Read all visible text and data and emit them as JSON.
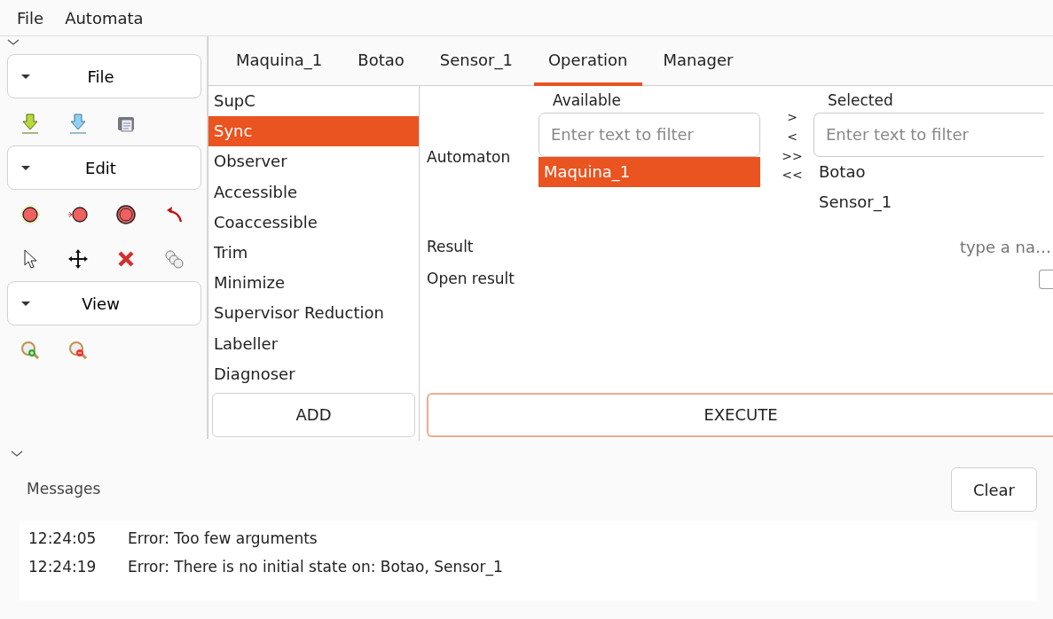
{
  "menu": [
    "File",
    "Automata"
  ],
  "sidebar": {
    "sections": [
      {
        "title": "File",
        "expanded": true
      },
      {
        "title": "Edit",
        "expanded": true
      },
      {
        "title": "View",
        "expanded": true
      }
    ]
  },
  "tabs": [
    {
      "label": "Maquina_1",
      "selected": false
    },
    {
      "label": "Botao",
      "selected": false
    },
    {
      "label": "Sensor_1",
      "selected": false
    },
    {
      "label": "Operation",
      "selected": true
    },
    {
      "label": "Manager",
      "selected": false
    }
  ],
  "operations": [
    {
      "label": "SupC",
      "selected": false
    },
    {
      "label": "Sync",
      "selected": true
    },
    {
      "label": "Observer",
      "selected": false
    },
    {
      "label": "Accessible",
      "selected": false
    },
    {
      "label": "Coaccessible",
      "selected": false
    },
    {
      "label": "Trim",
      "selected": false
    },
    {
      "label": "Minimize",
      "selected": false
    },
    {
      "label": "Supervisor Reduction",
      "selected": false
    },
    {
      "label": "Labeller",
      "selected": false
    },
    {
      "label": "Diagnoser",
      "selected": false
    }
  ],
  "add_button": "ADD",
  "automaton": {
    "label": "Automaton",
    "available": {
      "title": "Available",
      "placeholder": "Enter text to filter",
      "items": [
        {
          "label": "Maquina_1",
          "selected": true
        }
      ]
    },
    "move_buttons": [
      ">",
      "<",
      ">>",
      "<<"
    ],
    "selected": {
      "title": "Selected",
      "placeholder": "Enter text to filter",
      "items": [
        {
          "label": "Botao",
          "selected": false
        },
        {
          "label": "Sensor_1",
          "selected": false
        }
      ]
    }
  },
  "result": {
    "label": "Result",
    "placeholder": "type a na…"
  },
  "open_result": {
    "label": "Open result",
    "checked": false
  },
  "execute_button": "EXECUTE",
  "messages": {
    "title": "Messages",
    "clear_button": "Clear",
    "entries": [
      {
        "time": "12:24:05",
        "text": "Error: Too few arguments"
      },
      {
        "time": "12:24:19",
        "text": "Error: There is no initial state on: Botao, Sensor_1"
      }
    ]
  }
}
